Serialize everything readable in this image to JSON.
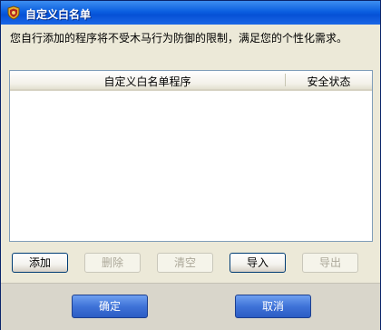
{
  "window": {
    "title": "自定义白名单",
    "description": "您自行添加的程序将不受木马行为防御的限制，满足您的个性化需求。"
  },
  "table": {
    "columns": [
      "自定义白名单程序",
      "安全状态"
    ],
    "rows": []
  },
  "buttons": {
    "add": "添加",
    "delete": "删除",
    "clear": "清空",
    "import": "导入",
    "export": "导出"
  },
  "footer": {
    "ok": "确定",
    "cancel": "取消"
  },
  "colors": {
    "titlebar": "#0b5fe0",
    "dialog_bg": "#ece9d8",
    "footer_bg": "#d9d6cb",
    "primary_button": "#3f73d8"
  }
}
